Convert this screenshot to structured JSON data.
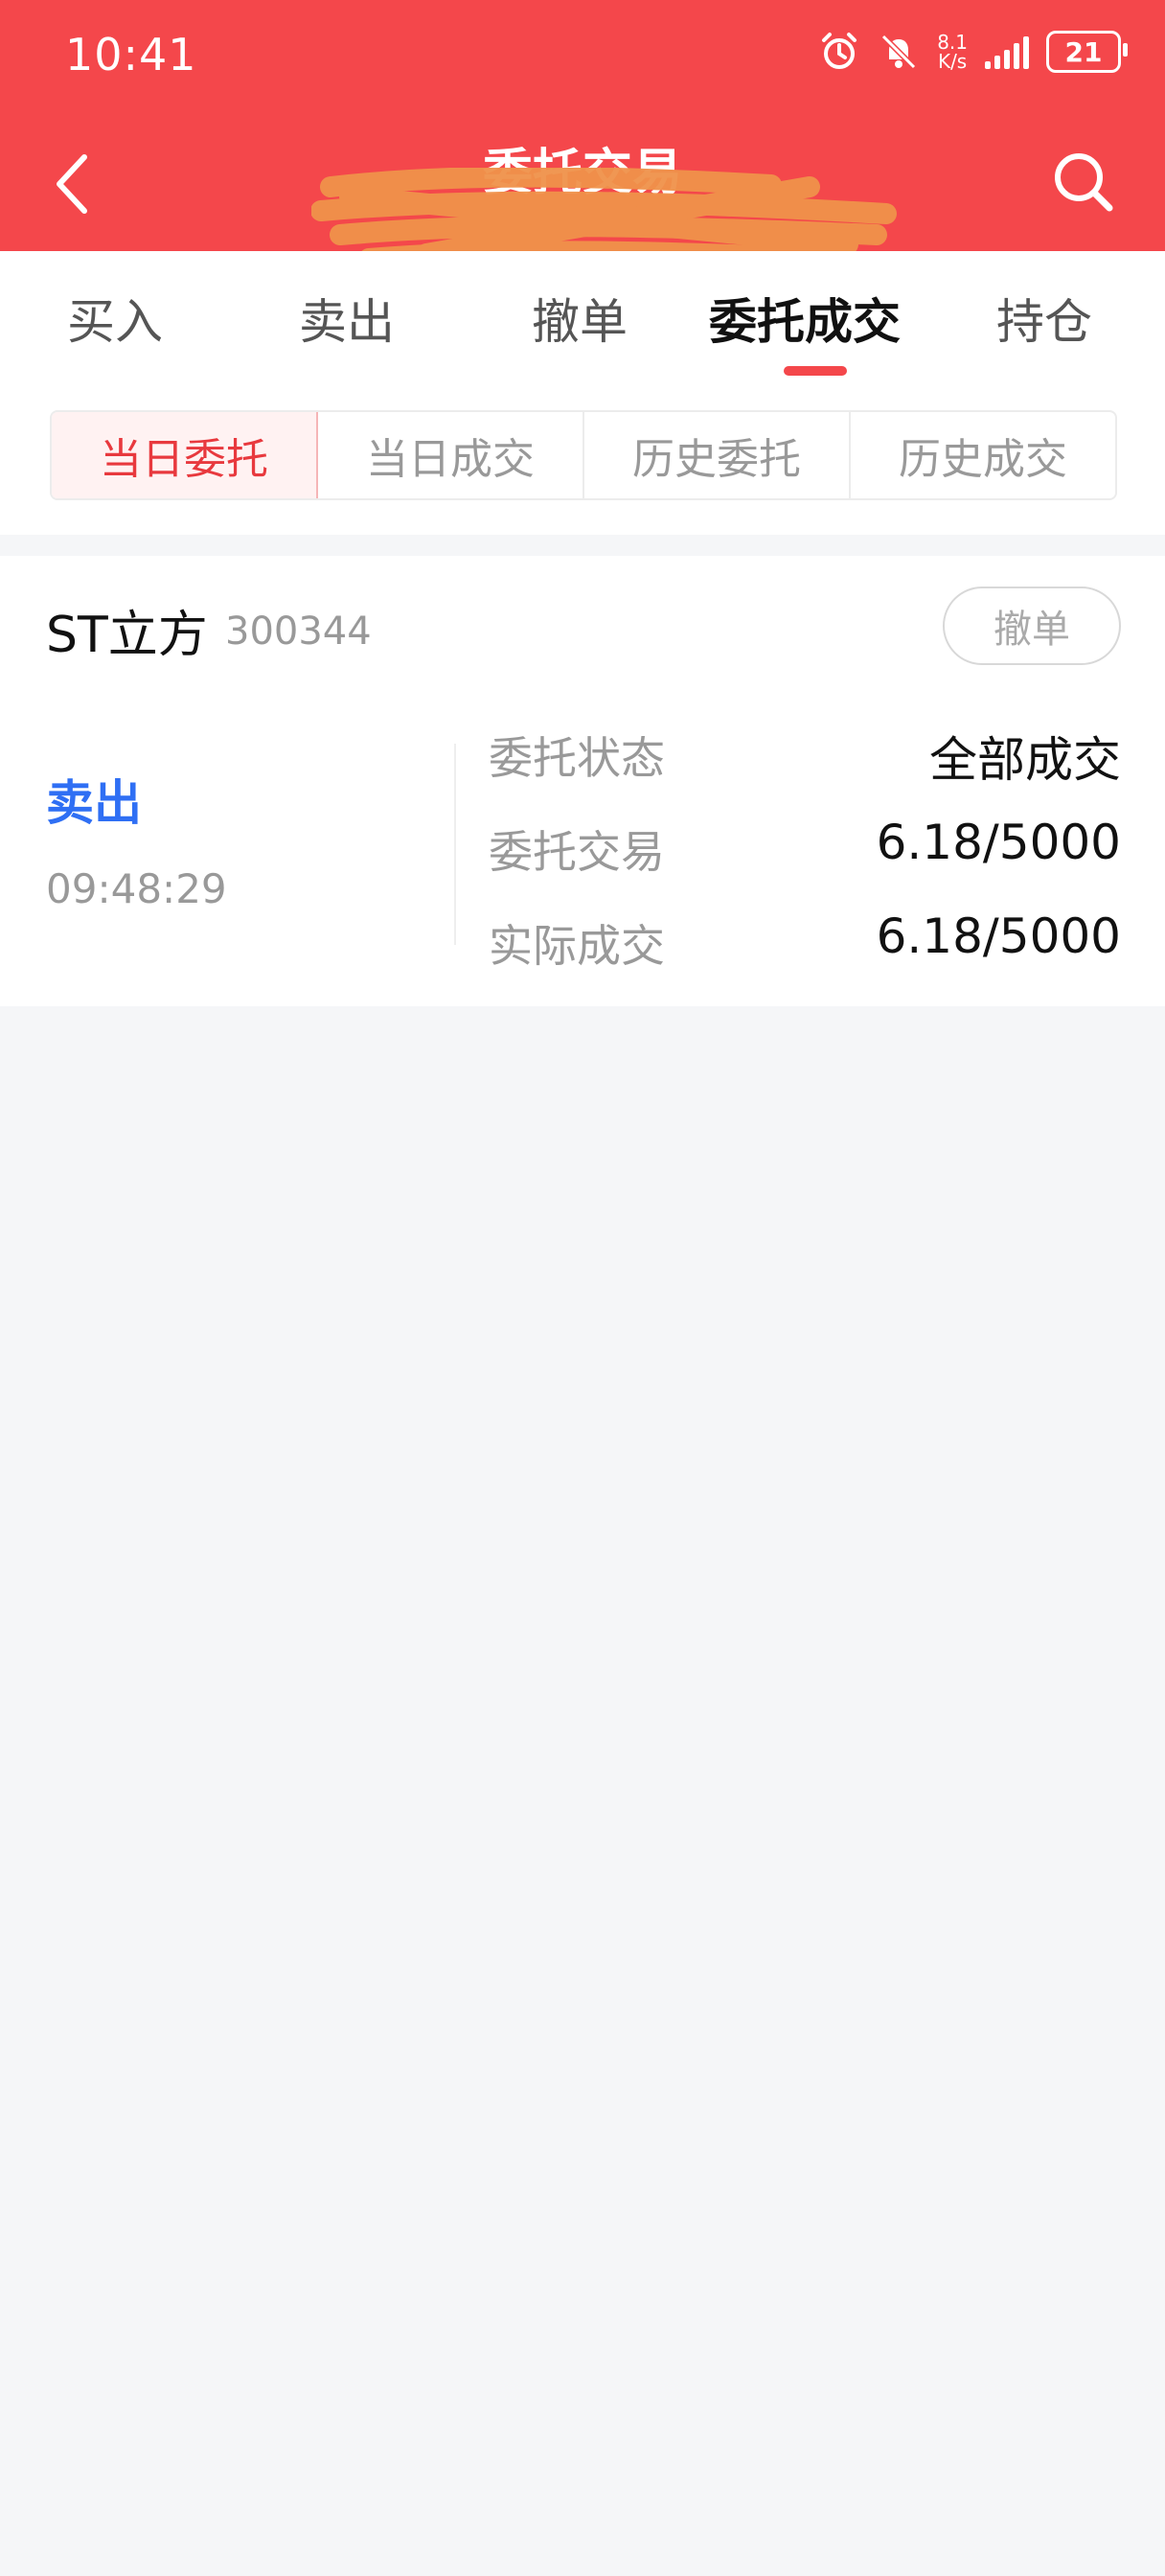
{
  "status_bar": {
    "time": "10:41",
    "net_speed_value": "8.1",
    "net_speed_unit": "K/s",
    "battery": "21"
  },
  "header": {
    "title": "委托交易",
    "account_info": "",
    "background_color": "#f4474b"
  },
  "tabs": [
    {
      "label": "买入",
      "active": false
    },
    {
      "label": "卖出",
      "active": false
    },
    {
      "label": "撤单",
      "active": false
    },
    {
      "label": "委托成交",
      "active": true
    },
    {
      "label": "持仓",
      "active": false
    }
  ],
  "sub_tabs": [
    {
      "label": "当日委托",
      "active": true
    },
    {
      "label": "当日成交",
      "active": false
    },
    {
      "label": "历史委托",
      "active": false
    },
    {
      "label": "历史成交",
      "active": false
    }
  ],
  "order": {
    "stock_name": "ST立方",
    "stock_code": "300344",
    "cancel_label": "撤单",
    "side": "卖出",
    "time": "09:48:29",
    "rows": [
      {
        "label": "委托状态",
        "value": "全部成交"
      },
      {
        "label": "委托交易",
        "value": "6.18/5000"
      },
      {
        "label": "实际成交",
        "value": "6.18/5000"
      }
    ]
  },
  "colors": {
    "accent_red": "#f4474b",
    "sell_blue": "#2f6ff4",
    "redaction_orange": "#f0924a"
  },
  "icons": [
    "alarm-icon",
    "bell-off-icon",
    "signal-icon",
    "battery-icon",
    "back-arrow-icon",
    "search-icon"
  ]
}
